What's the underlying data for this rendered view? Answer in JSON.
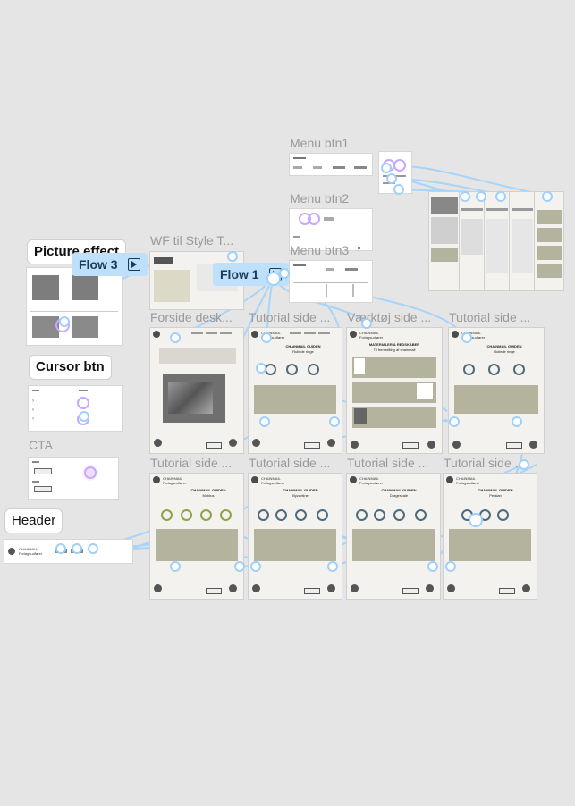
{
  "labels": {
    "menu_btn1": "Menu btn1",
    "menu_btn2": "Menu btn2",
    "menu_btn3": "Menu btn3",
    "wf_til_style": "WF til Style T...",
    "forside": "Forside desk...",
    "tutorial_1": "Tutorial side ...",
    "vaerktoej": "Værktøj side ...",
    "tutorial_2": "Tutorial side ...",
    "tutorial_3": "Tutorial side ...",
    "tutorial_4": "Tutorial side ...",
    "tutorial_5": "Tutorial side ...",
    "tutorial_6": "Tutorial side ..."
  },
  "components": {
    "picture_effect": "Picture effect",
    "cursor_btn": "Cursor btn",
    "cta": "CTA",
    "header": "Header"
  },
  "flows": {
    "flow1": "Flow 1",
    "flow3": "Flow 3"
  },
  "page_text": {
    "brand": "CHAINMAIL Forlagsudfører",
    "page_title_chainmail": "CHAINMAIL GUIDEN",
    "page_title_materialer": "MATERIALER & REDSKABER",
    "page_subtitle_materialer": "Til fremstilling af chainmail",
    "section_tang": "Flade tænger",
    "section_vaerktoej": "Værktøjer",
    "section_ringe": "Ringe",
    "sub_rullede": "Rullede ringe",
    "sub_mobius": "Mobius",
    "sub_byzantine": "Byzantine",
    "sub_dragescale": "Dragescale",
    "sub_pessy": "Persian",
    "step_label": "Trin 1",
    "link_next": "Næste",
    "cta_label": "Knap",
    "header_brand": "CHAINMAIL Forlagsudfører"
  },
  "colors": {
    "canvas": "#e5e5e5",
    "flow_line": "#9fd0fb",
    "flow_badge_bg": "#bfe0fb",
    "flow_badge_text": "#1a3b5c",
    "olive": "#b4b39e",
    "title_bar": "#d9d7cf",
    "frame_label": "#9a9a9a",
    "ring_blue": "#4d6b7d",
    "ring_green": "#8da345",
    "hover_purple": "#c8a8ff"
  }
}
